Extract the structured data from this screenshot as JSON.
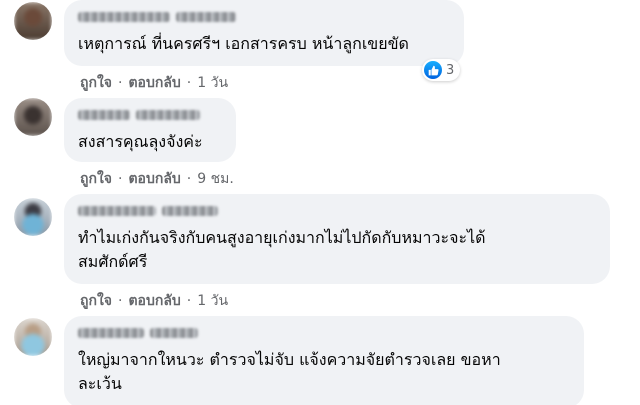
{
  "comments": [
    {
      "text": "เหตุการณ์ ที่นครศรีฯ เอกสารครบ หน้าลูกเขยขัด",
      "like_label": "ถูกใจ",
      "reply_label": "ตอบกลับ",
      "time": "1 วัน",
      "reaction_count": "3"
    },
    {
      "text": "สงสารคุณลุงจังค่ะ",
      "like_label": "ถูกใจ",
      "reply_label": "ตอบกลับ",
      "time": "9 ชม."
    },
    {
      "text": "ทำไมเก่งกันจริงกับคนสูงอายุเก่งมากไม่ไปกัดกับหมาวะจะได้\nสมศักด์ศรี",
      "like_label": "ถูกใจ",
      "reply_label": "ตอบกลับ",
      "time": "1 วัน"
    },
    {
      "text": "ใหญ่มาจากใหนวะ ตำรวจไม่จับ แจ้งความจัยตำรวจเลย ขอหา\nละเว้น"
    }
  ],
  "separator": "·",
  "icons": {
    "reaction": "like-thumb-icon"
  },
  "colors": {
    "bubble": "#f0f2f5",
    "action_text": "#65676b",
    "like_blue": "#1877f2"
  }
}
